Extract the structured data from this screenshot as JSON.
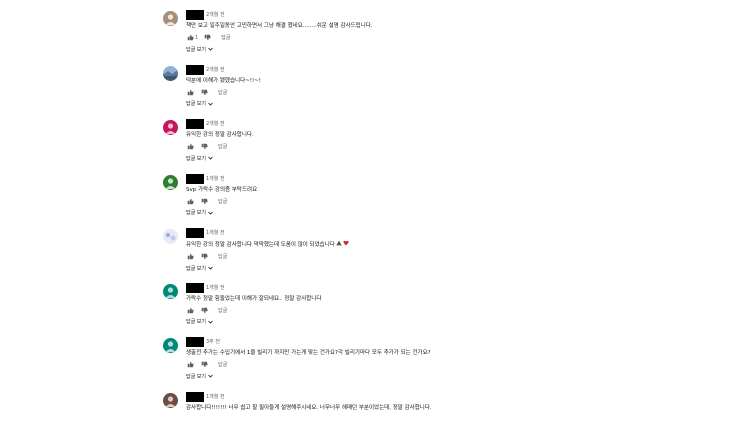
{
  "comments": [
    {
      "time": "2개월 전",
      "text": "책만 보고 일주일동안 고민하면서 그냥 해결 헸네요........쉬운 설명 감사드립니다.",
      "likes": "1",
      "reply_label": "답글",
      "replies_label": "답글 보기",
      "avatar_color": "#a58f7b"
    },
    {
      "time": "2개월 전",
      "text": "덕분에 이해가 됐헸습니다~!!~!",
      "likes": "",
      "reply_label": "답글",
      "replies_label": "답글 보기",
      "avatar_color": "#4a6a8a"
    },
    {
      "time": "2개월 전",
      "text": "유익한 강의 정말 감사합니다.",
      "likes": "",
      "reply_label": "답글",
      "replies_label": "답글 보기",
      "avatar_color": "#c2185b"
    },
    {
      "time": "1개월 전",
      "text": "Svp 가락수 강의좀 부탁드려요",
      "likes": "",
      "reply_label": "답글",
      "replies_label": "답글 보기",
      "avatar_color": "#2e7d32"
    },
    {
      "time": "1개월 전",
      "text": "유익한 강의 정말 감사합니다 막막했는데 도움이 많이 되었습니다",
      "likes": "",
      "reply_label": "답글",
      "replies_label": "답글 보기",
      "avatar_color": "#c5cae9"
    },
    {
      "time": "1개월 전",
      "text": "가락수 정말 힘들었는데 이해가 잘되네요.. 정말 감사합니다",
      "likes": "",
      "reply_label": "답글",
      "replies_label": "답글 보기",
      "avatar_color": "#00897b"
    },
    {
      "time": "3주 전",
      "text": "생출전 추가는 수입기에서 1을 빌리기 까지만 가는게 맞는 건가요?각 빌리기마다 모두 추가가 되는 건가요?",
      "likes": "",
      "reply_label": "답글",
      "replies_label": "답글 보기",
      "avatar_color": "#00897b"
    },
    {
      "time": "1개월 전",
      "text": "감사합니다!!!!!!! 너무 쉽고 할 필아들게 설명해주시네요. 너무너무 헤매던 부분이었는데, 정말 감사합니다.",
      "likes": "",
      "reply_label": "답글",
      "replies_label": "",
      "avatar_color": "#6d4c41"
    }
  ]
}
